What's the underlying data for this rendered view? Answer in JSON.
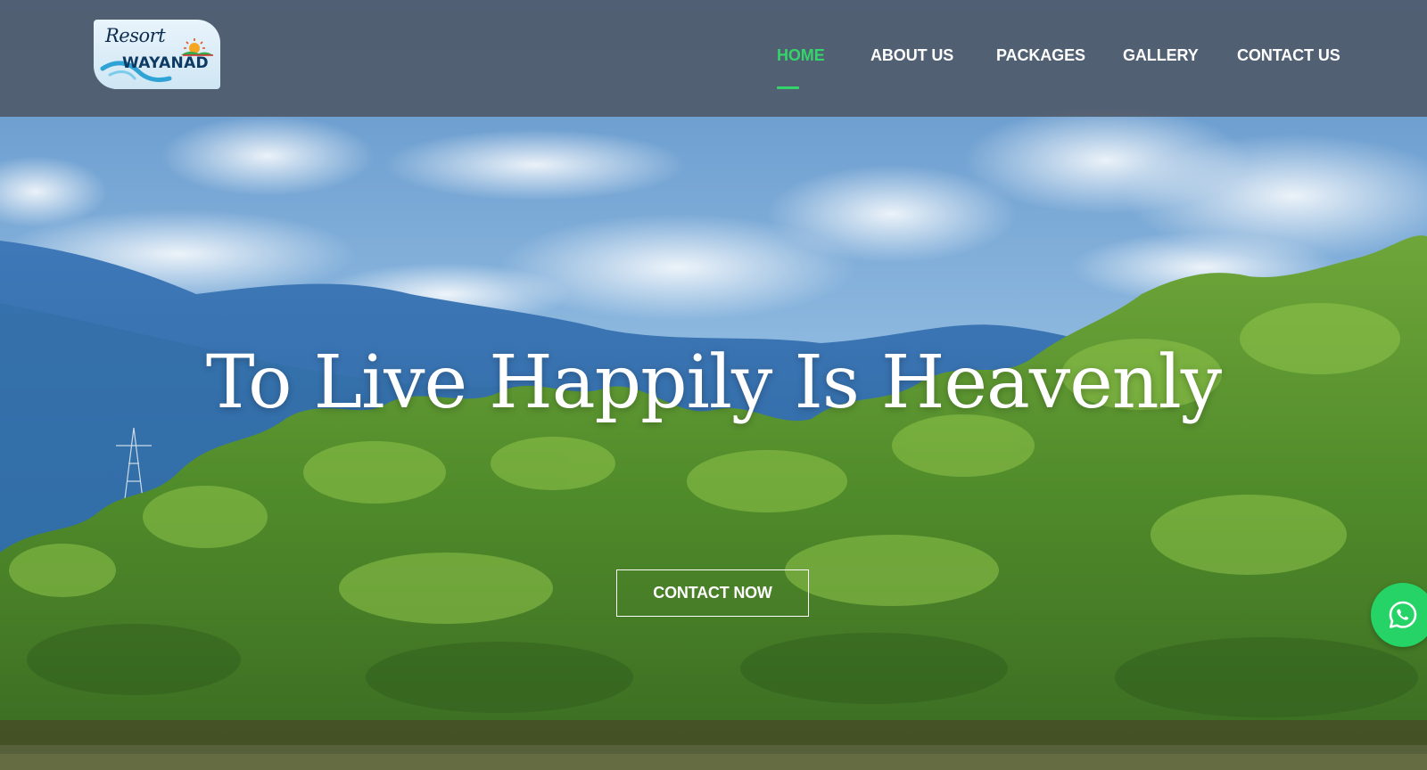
{
  "brand": {
    "logo_script": "Resort",
    "logo_main": "WAYANAD"
  },
  "nav": {
    "items": [
      {
        "label": "HOME",
        "active": true
      },
      {
        "label": "ABOUT US",
        "active": false
      },
      {
        "label": "PACKAGES",
        "active": false
      },
      {
        "label": "GALLERY",
        "active": false
      },
      {
        "label": "CONTACT US",
        "active": false
      }
    ]
  },
  "hero": {
    "headline": "To Live Happily Is Heavenly",
    "cta_label": "CONTACT NOW",
    "background": "mountains-forest-photo"
  },
  "floating": {
    "whatsapp_icon": "whatsapp-icon"
  },
  "colors": {
    "accent": "#35d46a",
    "header_bg": "#4e5664",
    "whatsapp": "#25d366"
  }
}
